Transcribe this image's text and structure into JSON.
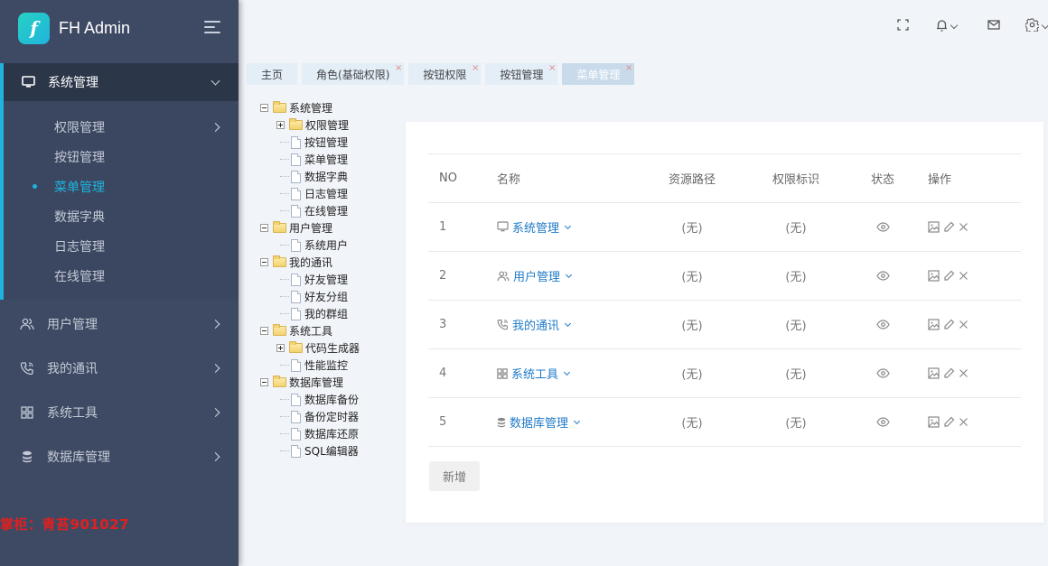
{
  "app": {
    "title": "FH Admin",
    "logo_letter": "f"
  },
  "sidebar": {
    "open_group": {
      "label": "系统管理",
      "icon": "monitor-icon",
      "children": [
        {
          "label": "权限管理",
          "has_children": true,
          "active": false
        },
        {
          "label": "按钮管理",
          "has_children": false,
          "active": false
        },
        {
          "label": "菜单管理",
          "has_children": false,
          "active": true
        },
        {
          "label": "数据字典",
          "has_children": false,
          "active": false
        },
        {
          "label": "日志管理",
          "has_children": false,
          "active": false
        },
        {
          "label": "在线管理",
          "has_children": false,
          "active": false
        }
      ]
    },
    "items": [
      {
        "label": "用户管理",
        "icon": "users-icon"
      },
      {
        "label": "我的通讯",
        "icon": "phone-icon"
      },
      {
        "label": "系统工具",
        "icon": "grid-icon"
      },
      {
        "label": "数据库管理",
        "icon": "database-icon"
      }
    ],
    "watermark": "掌柜：青苔901027"
  },
  "topbar": {
    "icons": [
      "fullscreen-icon",
      "bell-icon",
      "mail-icon",
      "gear-icon"
    ]
  },
  "tabs": [
    {
      "label": "主页",
      "closable": false,
      "active": false
    },
    {
      "label": "角色(基础权限)",
      "closable": true,
      "active": false
    },
    {
      "label": "按钮权限",
      "closable": true,
      "active": false
    },
    {
      "label": "按钮管理",
      "closable": true,
      "active": false
    },
    {
      "label": "菜单管理",
      "closable": true,
      "active": true
    }
  ],
  "tab_close_glyph": "×",
  "tree": [
    {
      "label": "系统管理",
      "type": "folder",
      "expanded": true,
      "children": [
        {
          "label": "权限管理",
          "type": "folder",
          "expanded": false
        },
        {
          "label": "按钮管理",
          "type": "page"
        },
        {
          "label": "菜单管理",
          "type": "page"
        },
        {
          "label": "数据字典",
          "type": "page"
        },
        {
          "label": "日志管理",
          "type": "page"
        },
        {
          "label": "在线管理",
          "type": "page"
        }
      ]
    },
    {
      "label": "用户管理",
      "type": "folder",
      "expanded": true,
      "children": [
        {
          "label": "系统用户",
          "type": "page"
        }
      ]
    },
    {
      "label": "我的通讯",
      "type": "folder",
      "expanded": true,
      "children": [
        {
          "label": "好友管理",
          "type": "page"
        },
        {
          "label": "好友分组",
          "type": "page"
        },
        {
          "label": "我的群组",
          "type": "page"
        }
      ]
    },
    {
      "label": "系统工具",
      "type": "folder",
      "expanded": true,
      "children": [
        {
          "label": "代码生成器",
          "type": "folder",
          "expanded": false
        },
        {
          "label": "性能监控",
          "type": "page"
        }
      ]
    },
    {
      "label": "数据库管理",
      "type": "folder",
      "expanded": true,
      "children": [
        {
          "label": "数据库备份",
          "type": "page"
        },
        {
          "label": "备份定时器",
          "type": "page"
        },
        {
          "label": "数据库还原",
          "type": "page"
        },
        {
          "label": "SQL编辑器",
          "type": "page"
        }
      ]
    }
  ],
  "table": {
    "headers": {
      "no": "NO",
      "name": "名称",
      "path": "资源路径",
      "perm": "权限标识",
      "status": "状态",
      "ops": "操作"
    },
    "rows": [
      {
        "no": "1",
        "icon": "monitor-icon",
        "name": "系统管理",
        "path": "(无)",
        "perm": "(无)",
        "status": "visible"
      },
      {
        "no": "2",
        "icon": "users-icon",
        "name": "用户管理",
        "path": "(无)",
        "perm": "(无)",
        "status": "visible"
      },
      {
        "no": "3",
        "icon": "phone-icon",
        "name": "我的通讯",
        "path": "(无)",
        "perm": "(无)",
        "status": "visible"
      },
      {
        "no": "4",
        "icon": "grid-icon",
        "name": "系统工具",
        "path": "(无)",
        "perm": "(无)",
        "status": "visible"
      },
      {
        "no": "5",
        "icon": "database-icon",
        "name": "数据库管理",
        "path": "(无)",
        "perm": "(无)",
        "status": "visible"
      }
    ],
    "add_button": "新增"
  },
  "colors": {
    "accent": "#1fb4de",
    "sidebar_bg": "#3e4a63",
    "link": "#1f7ac7",
    "watermark": "#e02020"
  }
}
